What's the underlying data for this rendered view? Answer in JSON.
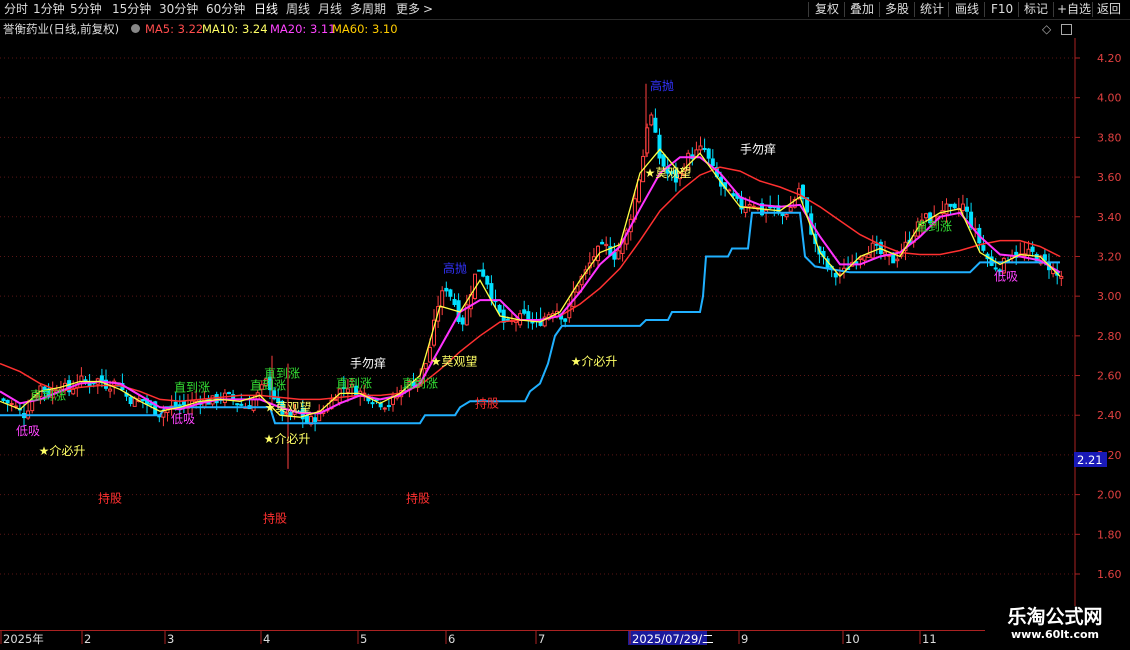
{
  "toolbar": {
    "periods": [
      "分时",
      "1分钟",
      "5分钟",
      "15分钟",
      "30分钟",
      "60分钟",
      "日线",
      "周线",
      "月线",
      "多周期",
      "更多"
    ],
    "active_period": "日线",
    "more_arrow": ">",
    "right_buttons": [
      "复权",
      "叠加",
      "多股",
      "统计",
      "画线",
      "F10",
      "标记",
      "+自选",
      "返回"
    ]
  },
  "info": {
    "stock_title": "誉衡药业(日线,前复权)",
    "ma5_label": "MA5: 3.22",
    "ma10_label": "MA10: 3.24",
    "ma20_label": "MA20: 3.11",
    "ma60_label": "MA60: 3.10",
    "colors": {
      "ma5": "#ff4d4d",
      "ma10": "#ffff66",
      "ma20": "#ff44ff",
      "ma60": "#ffcc00"
    }
  },
  "chart_data": {
    "type": "candlestick",
    "price_axis_ticks": [
      "4.20",
      "4.00",
      "3.80",
      "3.60",
      "3.40",
      "3.20",
      "3.00",
      "2.80",
      "2.60",
      "2.40",
      "2.20",
      "2.00",
      "1.80",
      "1.60"
    ],
    "ylim": [
      1.55,
      4.25
    ],
    "current_price_tag": "2.21",
    "month_labels": [
      "2025年",
      "2",
      "3",
      "4",
      "5",
      "6",
      "7",
      "2025/07/29/二",
      "9",
      "10",
      "11"
    ],
    "candle_color_up": "#ff4040",
    "candle_color_down": "#00e0ff",
    "close_path": [
      [
        0,
        2.48
      ],
      [
        12,
        2.45
      ],
      [
        22,
        2.4
      ],
      [
        30,
        2.47
      ],
      [
        38,
        2.55
      ],
      [
        48,
        2.5
      ],
      [
        58,
        2.56
      ],
      [
        68,
        2.52
      ],
      [
        78,
        2.58
      ],
      [
        88,
        2.56
      ],
      [
        96,
        2.58
      ],
      [
        106,
        2.55
      ],
      [
        116,
        2.57
      ],
      [
        124,
        2.5
      ],
      [
        132,
        2.47
      ],
      [
        140,
        2.48
      ],
      [
        150,
        2.44
      ],
      [
        158,
        2.41
      ],
      [
        166,
        2.43
      ],
      [
        176,
        2.45
      ],
      [
        186,
        2.45
      ],
      [
        196,
        2.48
      ],
      [
        206,
        2.47
      ],
      [
        216,
        2.48
      ],
      [
        226,
        2.5
      ],
      [
        236,
        2.46
      ],
      [
        246,
        2.44
      ],
      [
        256,
        2.5
      ],
      [
        266,
        2.58
      ],
      [
        276,
        2.45
      ],
      [
        286,
        2.38
      ],
      [
        296,
        2.42
      ],
      [
        306,
        2.36
      ],
      [
        316,
        2.4
      ],
      [
        326,
        2.44
      ],
      [
        336,
        2.52
      ],
      [
        346,
        2.55
      ],
      [
        356,
        2.52
      ],
      [
        366,
        2.5
      ],
      [
        376,
        2.47
      ],
      [
        386,
        2.45
      ],
      [
        396,
        2.5
      ],
      [
        406,
        2.55
      ],
      [
        416,
        2.58
      ],
      [
        426,
        2.68
      ],
      [
        436,
        2.95
      ],
      [
        444,
        3.05
      ],
      [
        452,
        2.98
      ],
      [
        460,
        2.85
      ],
      [
        468,
        3.0
      ],
      [
        476,
        3.15
      ],
      [
        484,
        3.1
      ],
      [
        494,
        2.95
      ],
      [
        504,
        2.85
      ],
      [
        514,
        2.88
      ],
      [
        524,
        2.9
      ],
      [
        534,
        2.85
      ],
      [
        544,
        2.9
      ],
      [
        554,
        2.94
      ],
      [
        564,
        2.88
      ],
      [
        574,
        3.05
      ],
      [
        584,
        3.12
      ],
      [
        594,
        3.22
      ],
      [
        604,
        3.25
      ],
      [
        614,
        3.2
      ],
      [
        624,
        3.3
      ],
      [
        634,
        3.5
      ],
      [
        642,
        3.72
      ],
      [
        648,
        3.95
      ],
      [
        652,
        3.85
      ],
      [
        658,
        3.7
      ],
      [
        666,
        3.62
      ],
      [
        676,
        3.58
      ],
      [
        686,
        3.7
      ],
      [
        694,
        3.72
      ],
      [
        702,
        3.75
      ],
      [
        710,
        3.65
      ],
      [
        720,
        3.55
      ],
      [
        730,
        3.5
      ],
      [
        740,
        3.45
      ],
      [
        750,
        3.48
      ],
      [
        760,
        3.42
      ],
      [
        770,
        3.45
      ],
      [
        780,
        3.4
      ],
      [
        790,
        3.45
      ],
      [
        798,
        3.55
      ],
      [
        806,
        3.4
      ],
      [
        814,
        3.25
      ],
      [
        822,
        3.18
      ],
      [
        832,
        3.1
      ],
      [
        842,
        3.12
      ],
      [
        852,
        3.18
      ],
      [
        862,
        3.22
      ],
      [
        872,
        3.25
      ],
      [
        882,
        3.2
      ],
      [
        892,
        3.18
      ],
      [
        902,
        3.24
      ],
      [
        912,
        3.32
      ],
      [
        922,
        3.4
      ],
      [
        932,
        3.38
      ],
      [
        942,
        3.45
      ],
      [
        952,
        3.42
      ],
      [
        962,
        3.46
      ],
      [
        970,
        3.36
      ],
      [
        980,
        3.25
      ],
      [
        990,
        3.15
      ],
      [
        1000,
        3.15
      ],
      [
        1010,
        3.22
      ],
      [
        1020,
        3.2
      ],
      [
        1030,
        3.22
      ],
      [
        1040,
        3.18
      ],
      [
        1048,
        3.15
      ],
      [
        1056,
        3.1
      ]
    ],
    "ma_red_path": [
      [
        0,
        2.66
      ],
      [
        20,
        2.62
      ],
      [
        40,
        2.56
      ],
      [
        60,
        2.52
      ],
      [
        80,
        2.54
      ],
      [
        100,
        2.55
      ],
      [
        120,
        2.55
      ],
      [
        140,
        2.52
      ],
      [
        160,
        2.48
      ],
      [
        180,
        2.47
      ],
      [
        200,
        2.48
      ],
      [
        220,
        2.49
      ],
      [
        240,
        2.5
      ],
      [
        260,
        2.5
      ],
      [
        280,
        2.49
      ],
      [
        300,
        2.48
      ],
      [
        320,
        2.48
      ],
      [
        340,
        2.49
      ],
      [
        360,
        2.5
      ],
      [
        380,
        2.5
      ],
      [
        400,
        2.51
      ],
      [
        420,
        2.55
      ],
      [
        440,
        2.63
      ],
      [
        460,
        2.72
      ],
      [
        480,
        2.8
      ],
      [
        500,
        2.87
      ],
      [
        520,
        2.88
      ],
      [
        540,
        2.88
      ],
      [
        560,
        2.9
      ],
      [
        580,
        2.96
      ],
      [
        600,
        3.04
      ],
      [
        620,
        3.14
      ],
      [
        640,
        3.28
      ],
      [
        660,
        3.43
      ],
      [
        680,
        3.53
      ],
      [
        700,
        3.61
      ],
      [
        720,
        3.65
      ],
      [
        740,
        3.63
      ],
      [
        760,
        3.58
      ],
      [
        780,
        3.55
      ],
      [
        800,
        3.51
      ],
      [
        820,
        3.45
      ],
      [
        840,
        3.38
      ],
      [
        860,
        3.31
      ],
      [
        880,
        3.26
      ],
      [
        900,
        3.22
      ],
      [
        920,
        3.21
      ],
      [
        940,
        3.21
      ],
      [
        960,
        3.23
      ],
      [
        980,
        3.26
      ],
      [
        1000,
        3.28
      ],
      [
        1020,
        3.28
      ],
      [
        1040,
        3.25
      ],
      [
        1060,
        3.2
      ]
    ],
    "ma_magenta_path": [
      [
        0,
        2.52
      ],
      [
        20,
        2.46
      ],
      [
        40,
        2.48
      ],
      [
        60,
        2.52
      ],
      [
        80,
        2.56
      ],
      [
        100,
        2.57
      ],
      [
        120,
        2.56
      ],
      [
        140,
        2.5
      ],
      [
        160,
        2.44
      ],
      [
        180,
        2.43
      ],
      [
        200,
        2.46
      ],
      [
        220,
        2.48
      ],
      [
        240,
        2.48
      ],
      [
        260,
        2.48
      ],
      [
        280,
        2.44
      ],
      [
        300,
        2.41
      ],
      [
        320,
        2.41
      ],
      [
        340,
        2.46
      ],
      [
        360,
        2.5
      ],
      [
        380,
        2.48
      ],
      [
        400,
        2.5
      ],
      [
        420,
        2.56
      ],
      [
        440,
        2.74
      ],
      [
        460,
        2.92
      ],
      [
        480,
        2.98
      ],
      [
        500,
        2.98
      ],
      [
        520,
        2.88
      ],
      [
        540,
        2.88
      ],
      [
        560,
        2.9
      ],
      [
        580,
        3.02
      ],
      [
        600,
        3.16
      ],
      [
        620,
        3.25
      ],
      [
        640,
        3.44
      ],
      [
        660,
        3.62
      ],
      [
        680,
        3.7
      ],
      [
        700,
        3.7
      ],
      [
        720,
        3.62
      ],
      [
        740,
        3.5
      ],
      [
        760,
        3.46
      ],
      [
        780,
        3.45
      ],
      [
        800,
        3.46
      ],
      [
        820,
        3.3
      ],
      [
        840,
        3.16
      ],
      [
        860,
        3.16
      ],
      [
        880,
        3.2
      ],
      [
        900,
        3.22
      ],
      [
        920,
        3.3
      ],
      [
        940,
        3.4
      ],
      [
        960,
        3.42
      ],
      [
        980,
        3.3
      ],
      [
        1000,
        3.21
      ],
      [
        1020,
        3.2
      ],
      [
        1040,
        3.18
      ],
      [
        1060,
        3.12
      ]
    ],
    "ma_yellow_path": [
      [
        0,
        2.47
      ],
      [
        20,
        2.43
      ],
      [
        40,
        2.52
      ],
      [
        60,
        2.54
      ],
      [
        80,
        2.57
      ],
      [
        100,
        2.57
      ],
      [
        120,
        2.53
      ],
      [
        140,
        2.47
      ],
      [
        160,
        2.42
      ],
      [
        180,
        2.44
      ],
      [
        200,
        2.47
      ],
      [
        220,
        2.48
      ],
      [
        240,
        2.47
      ],
      [
        260,
        2.5
      ],
      [
        280,
        2.4
      ],
      [
        300,
        2.39
      ],
      [
        320,
        2.42
      ],
      [
        340,
        2.51
      ],
      [
        360,
        2.51
      ],
      [
        380,
        2.46
      ],
      [
        400,
        2.51
      ],
      [
        420,
        2.6
      ],
      [
        440,
        2.95
      ],
      [
        460,
        2.92
      ],
      [
        480,
        3.08
      ],
      [
        500,
        2.9
      ],
      [
        520,
        2.88
      ],
      [
        540,
        2.87
      ],
      [
        560,
        2.92
      ],
      [
        580,
        3.08
      ],
      [
        600,
        3.22
      ],
      [
        620,
        3.26
      ],
      [
        640,
        3.62
      ],
      [
        660,
        3.74
      ],
      [
        680,
        3.62
      ],
      [
        700,
        3.72
      ],
      [
        720,
        3.58
      ],
      [
        740,
        3.45
      ],
      [
        760,
        3.44
      ],
      [
        780,
        3.43
      ],
      [
        800,
        3.5
      ],
      [
        820,
        3.22
      ],
      [
        840,
        3.1
      ],
      [
        860,
        3.2
      ],
      [
        880,
        3.24
      ],
      [
        900,
        3.2
      ],
      [
        920,
        3.36
      ],
      [
        940,
        3.42
      ],
      [
        960,
        3.44
      ],
      [
        980,
        3.22
      ],
      [
        1000,
        3.16
      ],
      [
        1020,
        3.21
      ],
      [
        1040,
        3.2
      ],
      [
        1060,
        3.1
      ]
    ],
    "support_line_path": [
      [
        0,
        2.4
      ],
      [
        160,
        2.4
      ],
      [
        165,
        2.44
      ],
      [
        270,
        2.44
      ],
      [
        275,
        2.36
      ],
      [
        420,
        2.36
      ],
      [
        425,
        2.4
      ],
      [
        455,
        2.4
      ],
      [
        460,
        2.44
      ],
      [
        470,
        2.47
      ],
      [
        525,
        2.47
      ],
      [
        530,
        2.52
      ],
      [
        540,
        2.56
      ],
      [
        548,
        2.66
      ],
      [
        555,
        2.8
      ],
      [
        562,
        2.85
      ],
      [
        640,
        2.85
      ],
      [
        646,
        2.88
      ],
      [
        668,
        2.88
      ],
      [
        672,
        2.92
      ],
      [
        700,
        2.92
      ],
      [
        703,
        3.0
      ],
      [
        706,
        3.2
      ],
      [
        728,
        3.2
      ],
      [
        732,
        3.24
      ],
      [
        748,
        3.24
      ],
      [
        752,
        3.42
      ],
      [
        800,
        3.42
      ],
      [
        805,
        3.2
      ],
      [
        815,
        3.15
      ],
      [
        850,
        3.12
      ],
      [
        970,
        3.12
      ],
      [
        980,
        3.17
      ],
      [
        1060,
        3.17
      ]
    ],
    "annotations": [
      {
        "text": "低吸",
        "x": 28,
        "price": 2.3,
        "color": "#ff44ff"
      },
      {
        "text": "★介必升",
        "x": 62,
        "price": 2.2,
        "color": "#ffff66"
      },
      {
        "text": "直到涨",
        "x": 48,
        "price": 2.48,
        "color": "#33dd33"
      },
      {
        "text": "低吸",
        "x": 183,
        "price": 2.36,
        "color": "#ff44ff"
      },
      {
        "text": "直到涨",
        "x": 192,
        "price": 2.52,
        "color": "#33dd33"
      },
      {
        "text": "直到涨",
        "x": 268,
        "price": 2.53,
        "color": "#33dd33"
      },
      {
        "text": "直到涨",
        "x": 282,
        "price": 2.59,
        "color": "#33dd33"
      },
      {
        "text": "★莫观望",
        "x": 288,
        "price": 2.42,
        "color": "#ffff66"
      },
      {
        "text": "★介必升",
        "x": 287,
        "price": 2.26,
        "color": "#ffff66"
      },
      {
        "text": "持股",
        "x": 110,
        "price": 1.96,
        "color": "#ff3030"
      },
      {
        "text": "持股",
        "x": 275,
        "price": 1.86,
        "color": "#ff3030"
      },
      {
        "text": "手勿痒",
        "x": 368,
        "price": 2.64,
        "color": "#ffffff"
      },
      {
        "text": "直到涨",
        "x": 354,
        "price": 2.54,
        "color": "#33dd33"
      },
      {
        "text": "直到涨",
        "x": 420,
        "price": 2.54,
        "color": "#33dd33"
      },
      {
        "text": "★莫观望",
        "x": 454,
        "price": 2.65,
        "color": "#ffff66"
      },
      {
        "text": "持股",
        "x": 487,
        "price": 2.44,
        "color": "#ff3030"
      },
      {
        "text": "持股",
        "x": 418,
        "price": 1.96,
        "color": "#ff3030"
      },
      {
        "text": "高抛",
        "x": 455,
        "price": 3.12,
        "color": "#3333ff"
      },
      {
        "text": "★介必升",
        "x": 594,
        "price": 2.65,
        "color": "#ffff66"
      },
      {
        "text": "高抛",
        "x": 662,
        "price": 4.04,
        "color": "#3333ff"
      },
      {
        "text": "★莫观望",
        "x": 668,
        "price": 3.6,
        "color": "#ffff66"
      },
      {
        "text": "手勿痒",
        "x": 758,
        "price": 3.72,
        "color": "#ffffff"
      },
      {
        "text": "直到涨",
        "x": 934,
        "price": 3.33,
        "color": "#33dd33"
      },
      {
        "text": "低吸",
        "x": 1006,
        "price": 3.08,
        "color": "#ff44ff"
      }
    ]
  },
  "icons": {
    "diamond": "◇",
    "small_box": "▫"
  },
  "watermark": {
    "line1": "乐淘公式网",
    "line2": "www.60lt.com"
  }
}
